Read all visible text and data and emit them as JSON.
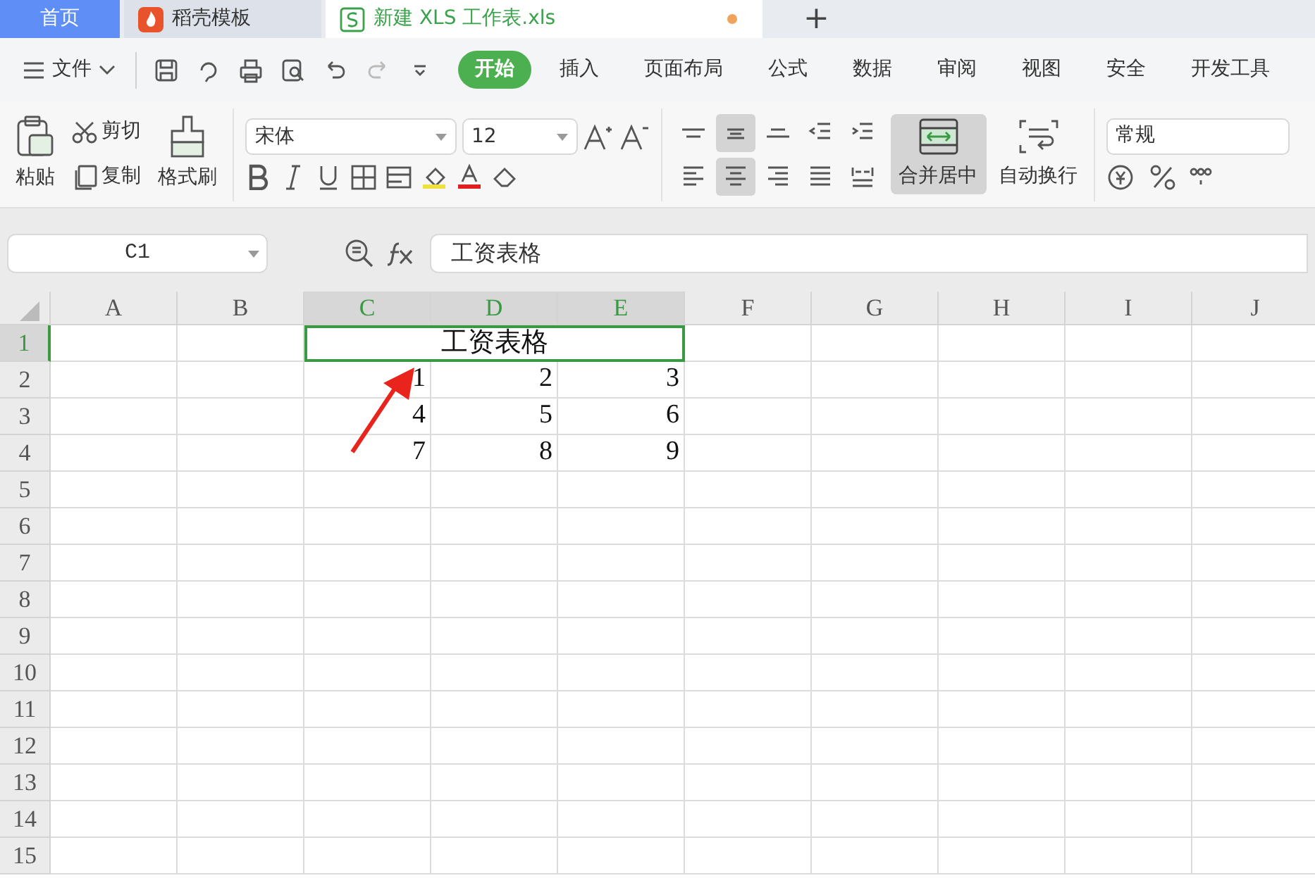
{
  "tabs": [
    {
      "label": "首页",
      "kind": "home",
      "selected": false
    },
    {
      "label": "稻壳模板",
      "kind": "template",
      "selected": false
    },
    {
      "label": "新建 XLS 工作表.xls",
      "kind": "sheet",
      "selected": true,
      "unsaved": true
    }
  ],
  "new_tab": "+",
  "menu": {
    "file": "文件",
    "ribbon_tabs": [
      {
        "label": "开始",
        "selected": true
      },
      {
        "label": "插入",
        "selected": false
      },
      {
        "label": "页面布局",
        "selected": false
      },
      {
        "label": "公式",
        "selected": false
      },
      {
        "label": "数据",
        "selected": false
      },
      {
        "label": "审阅",
        "selected": false
      },
      {
        "label": "视图",
        "selected": false
      },
      {
        "label": "安全",
        "selected": false
      },
      {
        "label": "开发工具",
        "selected": false
      }
    ]
  },
  "ribbon": {
    "paste": "粘贴",
    "cut": "剪切",
    "copy": "复制",
    "format_painter": "格式刷",
    "font_name": "宋体",
    "font_size": "12",
    "align_buttons": [
      {
        "kind": "top",
        "selected": false
      },
      {
        "kind": "middle",
        "selected": true
      },
      {
        "kind": "bottom",
        "selected": false
      },
      {
        "kind": "outdent",
        "selected": false
      },
      {
        "kind": "indent",
        "selected": false
      },
      {
        "kind": "left",
        "selected": false
      },
      {
        "kind": "center",
        "selected": true
      },
      {
        "kind": "right",
        "selected": false
      },
      {
        "kind": "justify",
        "selected": false
      },
      {
        "kind": "distribute",
        "selected": false
      }
    ],
    "merge": {
      "label": "合并居中",
      "selected": true
    },
    "wrap": "自动换行",
    "number_format": "常规"
  },
  "formula_bar": {
    "name_box": "C1",
    "formula": "工资表格"
  },
  "sheet": {
    "columns": [
      {
        "label": "A",
        "selected": false
      },
      {
        "label": "B",
        "selected": false
      },
      {
        "label": "C",
        "selected": true
      },
      {
        "label": "D",
        "selected": true
      },
      {
        "label": "E",
        "selected": true
      },
      {
        "label": "F",
        "selected": false
      },
      {
        "label": "G",
        "selected": false
      },
      {
        "label": "H",
        "selected": false
      },
      {
        "label": "I",
        "selected": false
      },
      {
        "label": "J",
        "selected": false
      }
    ],
    "rows": [
      {
        "label": "1",
        "selected": true,
        "cells": [
          null,
          null,
          {
            "kind": "merged",
            "text": "工资表格"
          }
        ]
      },
      {
        "label": "2",
        "selected": false,
        "cells": [
          null,
          null,
          {
            "kind": "number",
            "text": "1"
          },
          {
            "kind": "number",
            "text": "2"
          },
          {
            "kind": "number",
            "text": "3"
          }
        ]
      },
      {
        "label": "3",
        "selected": false,
        "cells": [
          null,
          null,
          {
            "kind": "number",
            "text": "4"
          },
          {
            "kind": "number",
            "text": "5"
          },
          {
            "kind": "number",
            "text": "6"
          }
        ]
      },
      {
        "label": "4",
        "selected": false,
        "cells": [
          null,
          null,
          {
            "kind": "number",
            "text": "7"
          },
          {
            "kind": "number",
            "text": "8"
          },
          {
            "kind": "number",
            "text": "9"
          }
        ]
      },
      {
        "label": "5",
        "selected": false,
        "cells": []
      },
      {
        "label": "6",
        "selected": false,
        "cells": []
      },
      {
        "label": "7",
        "selected": false,
        "cells": []
      },
      {
        "label": "8",
        "selected": false,
        "cells": []
      },
      {
        "label": "9",
        "selected": false,
        "cells": []
      },
      {
        "label": "10",
        "selected": false,
        "cells": []
      },
      {
        "label": "11",
        "selected": false,
        "cells": []
      },
      {
        "label": "12",
        "selected": false,
        "cells": []
      },
      {
        "label": "13",
        "selected": false,
        "cells": []
      },
      {
        "label": "14",
        "selected": false,
        "cells": []
      },
      {
        "label": "15",
        "selected": false,
        "cells": []
      }
    ]
  }
}
